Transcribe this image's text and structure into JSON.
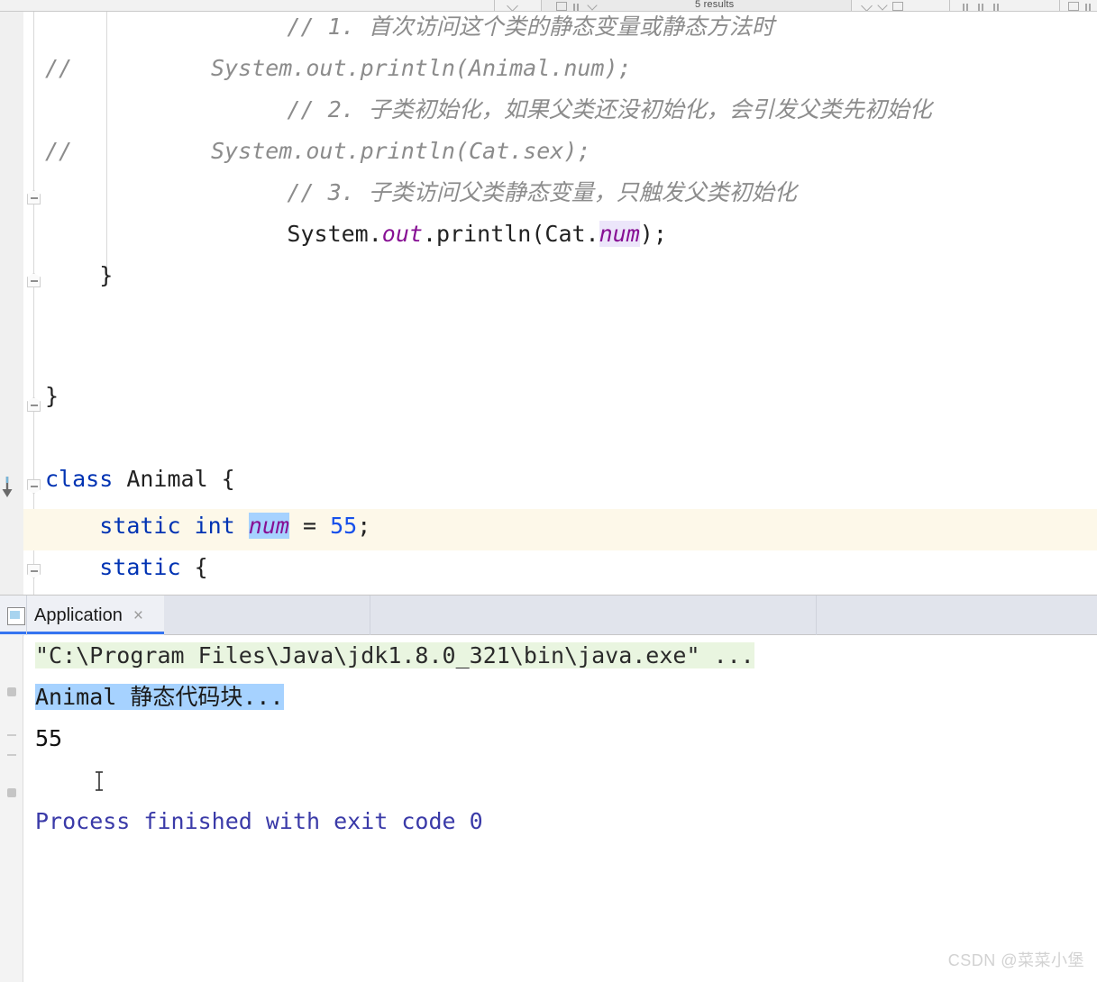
{
  "toolbar": {
    "results_label": "5 results",
    "icons": [
      "chevron-left-icon",
      "expand-icon",
      "collapse-icon",
      "chevron-down-icon",
      "prev-occurrence-icon",
      "next-occurrence-icon",
      "export-icon",
      "split-vertical-icon",
      "split-horizontal-icon",
      "split-icon",
      "settings-icon",
      "more-icon"
    ]
  },
  "editor": {
    "lines": [
      {
        "id": "line-comment-1",
        "segments": [
          {
            "text": "        // 1. 首次访问这个类的静态变量或静态方法时",
            "style": "comment"
          }
        ]
      },
      {
        "id": "line-commented-println-animal",
        "segments": [
          {
            "text": "//          System.out.println(Animal.num);",
            "style": "comment"
          }
        ]
      },
      {
        "id": "line-comment-2",
        "segments": [
          {
            "text": "        // 2. 子类初始化，如果父类还没初始化，会引发父类先初始化",
            "style": "comment"
          }
        ]
      },
      {
        "id": "line-commented-println-cat-sex",
        "segments": [
          {
            "text": "//          System.out.println(Cat.sex);",
            "style": "comment"
          }
        ]
      },
      {
        "id": "line-comment-3",
        "segments": [
          {
            "text": "        // 3. 子类访问父类静态变量，只触发父类初始化",
            "style": "comment"
          }
        ]
      },
      {
        "id": "line-println-cat-num",
        "segments": [
          {
            "text": "        System.",
            "style": "plain"
          },
          {
            "text": "out",
            "style": "field"
          },
          {
            "text": ".println(Cat.",
            "style": "plain"
          },
          {
            "text": "num",
            "style": "field-highlight"
          },
          {
            "text": ");",
            "style": "plain"
          }
        ]
      },
      {
        "id": "line-close-method-brace",
        "segments": [
          {
            "text": "    }",
            "style": "plain"
          }
        ]
      },
      {
        "id": "line-blank-1",
        "segments": [
          {
            "text": "",
            "style": "plain"
          }
        ]
      },
      {
        "id": "line-blank-2",
        "segments": [
          {
            "text": "",
            "style": "plain"
          }
        ]
      },
      {
        "id": "line-close-class-brace",
        "segments": [
          {
            "text": "}",
            "style": "plain"
          }
        ]
      },
      {
        "id": "line-blank-3",
        "segments": [
          {
            "text": "",
            "style": "plain"
          }
        ]
      },
      {
        "id": "line-class-animal",
        "segments": [
          {
            "text": "class",
            "style": "keyword"
          },
          {
            "text": " Animal {",
            "style": "plain"
          }
        ]
      },
      {
        "id": "line-static-int-num",
        "highlighted": true,
        "segments": [
          {
            "text": "    ",
            "style": "plain"
          },
          {
            "text": "static int ",
            "style": "keyword"
          },
          {
            "text": "num",
            "style": "field-selected"
          },
          {
            "text": " = ",
            "style": "plain"
          },
          {
            "text": "55",
            "style": "number"
          },
          {
            "text": ";",
            "style": "plain"
          }
        ]
      },
      {
        "id": "line-static-block",
        "segments": [
          {
            "text": "    ",
            "style": "plain"
          },
          {
            "text": "static",
            "style": "keyword"
          },
          {
            "text": " {",
            "style": "plain"
          }
        ]
      }
    ]
  },
  "console": {
    "tab": {
      "label": "Application",
      "close_label": "×",
      "icon": "application-window-icon"
    },
    "output": [
      {
        "id": "output-command-line",
        "style": "command",
        "text": "\"C:\\Program Files\\Java\\jdk1.8.0_321\\bin\\java.exe\" ...",
        "highlight_color": "#e9f5e0"
      },
      {
        "id": "output-selected-line",
        "style": "selected",
        "text": "Animal 静态代码块...",
        "highlight_color": "#a6d2ff"
      },
      {
        "id": "output-value-line",
        "style": "plain",
        "text": "55"
      },
      {
        "id": "output-blank-line",
        "style": "plain",
        "text": ""
      },
      {
        "id": "output-exit-line",
        "style": "exit",
        "text": "Process finished with exit code 0"
      }
    ]
  },
  "watermark": {
    "text": "CSDN @菜菜小堡"
  },
  "colors": {
    "keyword": "#0033b3",
    "number": "#1750eb",
    "field": "#871094",
    "comment": "#8c8c8c",
    "line_highlight": "#fdf8e9",
    "selection": "#a6d2ff",
    "command_highlight": "#e9f5e0",
    "tab_accent": "#3574f0"
  }
}
